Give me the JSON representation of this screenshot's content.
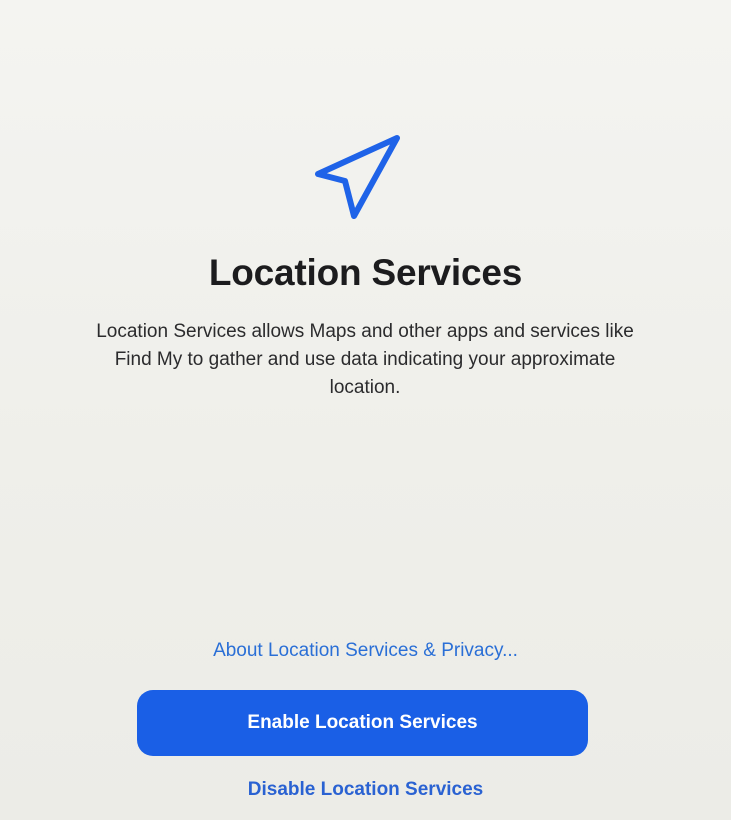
{
  "icon": "location-arrow-icon",
  "title": "Location Services",
  "description": "Location Services allows Maps and other apps and services like Find My to gather and use data indicating your approximate location.",
  "links": {
    "about": "About Location Services & Privacy..."
  },
  "buttons": {
    "enable": "Enable Location Services",
    "disable": "Disable Location Services"
  },
  "colors": {
    "accent": "#1a5fe6",
    "link": "#2a6fd6",
    "background": "#f0f0ec",
    "title": "#1c1c1e"
  }
}
